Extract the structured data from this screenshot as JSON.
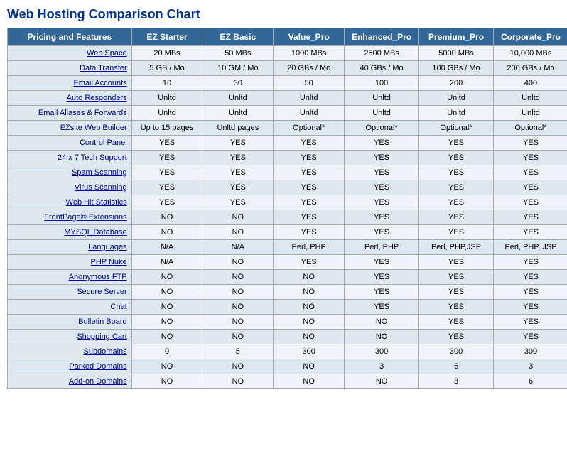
{
  "title": "Web Hosting Comparison Chart",
  "table": {
    "headers": [
      "Pricing and Features",
      "EZ Starter",
      "EZ Basic",
      "Value_Pro",
      "Enhanced_Pro",
      "Premium_Pro",
      "Corporate_Pro"
    ],
    "rows": [
      {
        "feature": "Web Space",
        "ez_starter": "20 MBs",
        "ez_basic": "50 MBs",
        "value_pro": "1000 MBs",
        "enhanced_pro": "2500 MBs",
        "premium_pro": "5000 MBs",
        "corporate_pro": "10,000 MBs"
      },
      {
        "feature": "Data Transfer",
        "ez_starter": "5 GB / Mo",
        "ez_basic": "10 GM / Mo",
        "value_pro": "20 GBs / Mo",
        "enhanced_pro": "40 GBs / Mo",
        "premium_pro": "100 GBs / Mo",
        "corporate_pro": "200 GBs / Mo"
      },
      {
        "feature": "Email Accounts",
        "ez_starter": "10",
        "ez_basic": "30",
        "value_pro": "50",
        "enhanced_pro": "100",
        "premium_pro": "200",
        "corporate_pro": "400"
      },
      {
        "feature": "Auto Responders",
        "ez_starter": "Unltd",
        "ez_basic": "Unltd",
        "value_pro": "Unltd",
        "enhanced_pro": "Unltd",
        "premium_pro": "Unltd",
        "corporate_pro": "Unltd"
      },
      {
        "feature": "Email Aliases & Forwards",
        "ez_starter": "Unltd",
        "ez_basic": "Unltd",
        "value_pro": "Unltd",
        "enhanced_pro": "Unltd",
        "premium_pro": "Unltd",
        "corporate_pro": "Unltd"
      },
      {
        "feature": "EZsite Web Builder",
        "ez_starter": "Up to 15 pages",
        "ez_basic": "Unltd pages",
        "value_pro": "Optional*",
        "enhanced_pro": "Optional*",
        "premium_pro": "Optional*",
        "corporate_pro": "Optional*"
      },
      {
        "feature": "Control Panel",
        "ez_starter": "YES",
        "ez_basic": "YES",
        "value_pro": "YES",
        "enhanced_pro": "YES",
        "premium_pro": "YES",
        "corporate_pro": "YES"
      },
      {
        "feature": "24 x 7 Tech Support",
        "ez_starter": "YES",
        "ez_basic": "YES",
        "value_pro": "YES",
        "enhanced_pro": "YES",
        "premium_pro": "YES",
        "corporate_pro": "YES"
      },
      {
        "feature": "Spam Scanning",
        "ez_starter": "YES",
        "ez_basic": "YES",
        "value_pro": "YES",
        "enhanced_pro": "YES",
        "premium_pro": "YES",
        "corporate_pro": "YES"
      },
      {
        "feature": "Virus Scanning",
        "ez_starter": "YES",
        "ez_basic": "YES",
        "value_pro": "YES",
        "enhanced_pro": "YES",
        "premium_pro": "YES",
        "corporate_pro": "YES"
      },
      {
        "feature": "Web Hit Statistics",
        "ez_starter": "YES",
        "ez_basic": "YES",
        "value_pro": "YES",
        "enhanced_pro": "YES",
        "premium_pro": "YES",
        "corporate_pro": "YES"
      },
      {
        "feature": "FrontPage® Extensions",
        "ez_starter": "NO",
        "ez_basic": "NO",
        "value_pro": "YES",
        "enhanced_pro": "YES",
        "premium_pro": "YES",
        "corporate_pro": "YES"
      },
      {
        "feature": "MYSQL Database",
        "ez_starter": "NO",
        "ez_basic": "NO",
        "value_pro": "YES",
        "enhanced_pro": "YES",
        "premium_pro": "YES",
        "corporate_pro": "YES"
      },
      {
        "feature": "Languages",
        "ez_starter": "N/A",
        "ez_basic": "N/A",
        "value_pro": "Perl, PHP",
        "enhanced_pro": "Perl, PHP",
        "premium_pro": "Perl, PHP,JSP",
        "corporate_pro": "Perl, PHP, JSP"
      },
      {
        "feature": "PHP Nuke",
        "ez_starter": "N/A",
        "ez_basic": "NO",
        "value_pro": "YES",
        "enhanced_pro": "YES",
        "premium_pro": "YES",
        "corporate_pro": "YES"
      },
      {
        "feature": "Anonymous FTP",
        "ez_starter": "NO",
        "ez_basic": "NO",
        "value_pro": "NO",
        "enhanced_pro": "YES",
        "premium_pro": "YES",
        "corporate_pro": "YES"
      },
      {
        "feature": "Secure Server",
        "ez_starter": "NO",
        "ez_basic": "NO",
        "value_pro": "NO",
        "enhanced_pro": "YES",
        "premium_pro": "YES",
        "corporate_pro": "YES"
      },
      {
        "feature": "Chat",
        "ez_starter": "NO",
        "ez_basic": "NO",
        "value_pro": "NO",
        "enhanced_pro": "YES",
        "premium_pro": "YES",
        "corporate_pro": "YES"
      },
      {
        "feature": "Bulletin Board",
        "ez_starter": "NO",
        "ez_basic": "NO",
        "value_pro": "NO",
        "enhanced_pro": "NO",
        "premium_pro": "YES",
        "corporate_pro": "YES"
      },
      {
        "feature": "Shopping Cart",
        "ez_starter": "NO",
        "ez_basic": "NO",
        "value_pro": "NO",
        "enhanced_pro": "NO",
        "premium_pro": "YES",
        "corporate_pro": "YES"
      },
      {
        "feature": "Subdomains",
        "ez_starter": "0",
        "ez_basic": "5",
        "value_pro": "300",
        "enhanced_pro": "300",
        "premium_pro": "300",
        "corporate_pro": "300"
      },
      {
        "feature": "Parked Domains",
        "ez_starter": "NO",
        "ez_basic": "NO",
        "value_pro": "NO",
        "enhanced_pro": "3",
        "premium_pro": "6",
        "corporate_pro": "3"
      },
      {
        "feature": "Add-on Domains",
        "ez_starter": "NO",
        "ez_basic": "NO",
        "value_pro": "NO",
        "enhanced_pro": "NO",
        "premium_pro": "3",
        "corporate_pro": "6"
      }
    ]
  }
}
